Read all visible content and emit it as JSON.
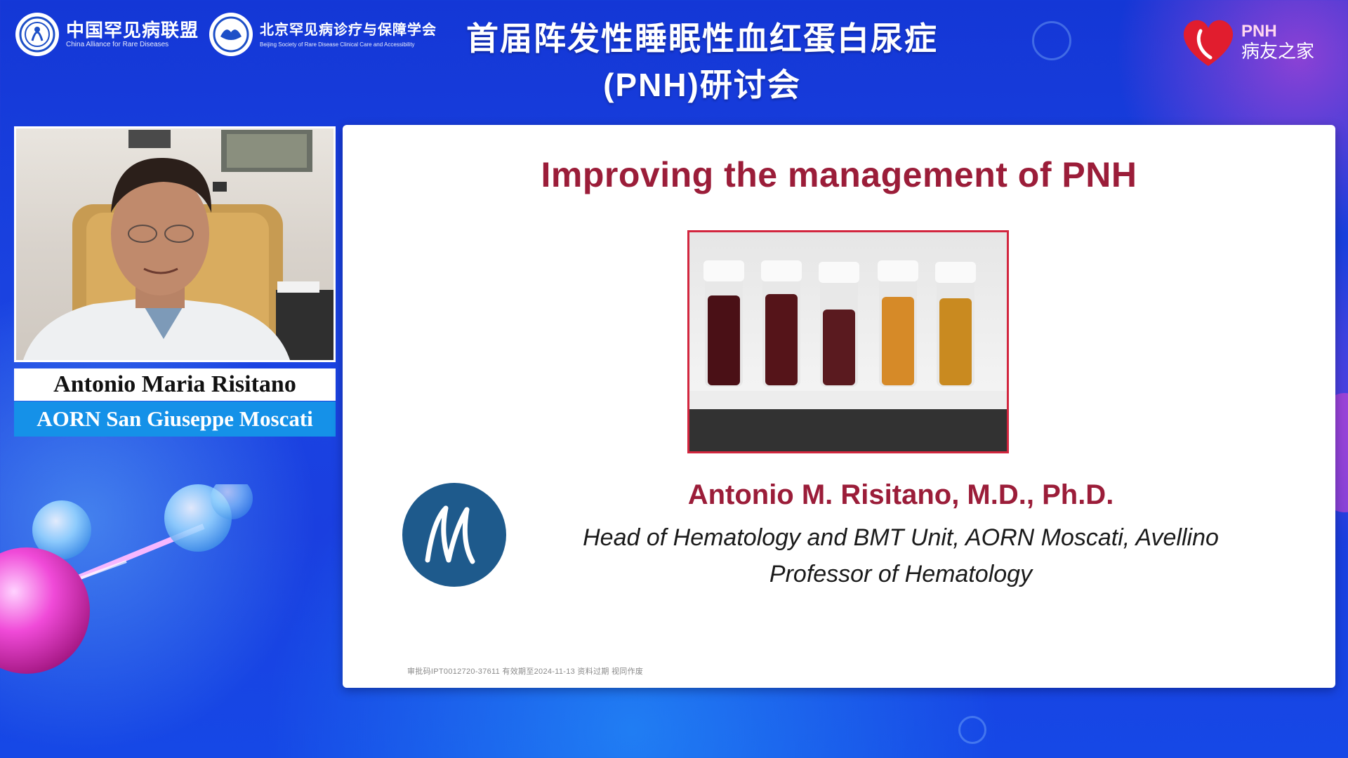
{
  "header": {
    "logo_left": {
      "cn": "中国罕见病联盟",
      "en": "China Alliance for Rare Diseases"
    },
    "logo_mid": {
      "cn": "北京罕见病诊疗与保障学会",
      "en": "Beijing Society of Rare Disease Clinical Care and Accessibility"
    },
    "title_line1": "首届阵发性睡眠性血红蛋白尿症",
    "title_line2": "(PNH)研讨会",
    "brand": {
      "line1": "PNH",
      "line2": "病友之家"
    }
  },
  "speaker": {
    "name": "Antonio Maria Risitano",
    "organization": "AORN San Giuseppe Moscati"
  },
  "slide": {
    "title": "Improving the management of PNH",
    "author": "Antonio M. Risitano, M.D., Ph.D.",
    "affiliation_line1": "Head of Hematology and BMT Unit, AORN Moscati, Avellino",
    "affiliation_line2": "Professor of Hematology",
    "footnote": "审批码IPT0012720-37611   有效期至2024-11-13   资料过期   视同作废"
  },
  "colors": {
    "background": "#1a3fe0",
    "slide_title": "#9b1d39",
    "org_banner": "#1591e8",
    "photo_border": "#d2263e",
    "m_logo": "#1e5a8c"
  },
  "icons": {
    "logo_left": "rare-disease-alliance-logo-icon",
    "logo_mid": "beijing-society-logo-icon",
    "brand": "pnh-heart-logo-icon",
    "slide_logo": "m-monogram-logo-icon"
  }
}
